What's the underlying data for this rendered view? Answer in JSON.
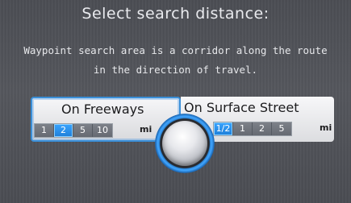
{
  "screen": {
    "title": "Select search distance:",
    "description_lines": [
      "Waypoint search area is a corridor along the route",
      "in the direction of travel."
    ]
  },
  "options": {
    "freeways": {
      "label": "On Freeways",
      "unit": "mi",
      "values": [
        "1",
        "2",
        "5",
        "10"
      ],
      "selected_index": 1,
      "focused": true
    },
    "surface": {
      "label": "On Surface Street",
      "unit": "mi",
      "values": [
        "1/2",
        "1",
        "2",
        "5"
      ],
      "selected_index": 0,
      "focused": false
    }
  },
  "colors": {
    "accent": "#2f86d6",
    "selected_segment": "#1f7fd8",
    "background": "#505258"
  }
}
